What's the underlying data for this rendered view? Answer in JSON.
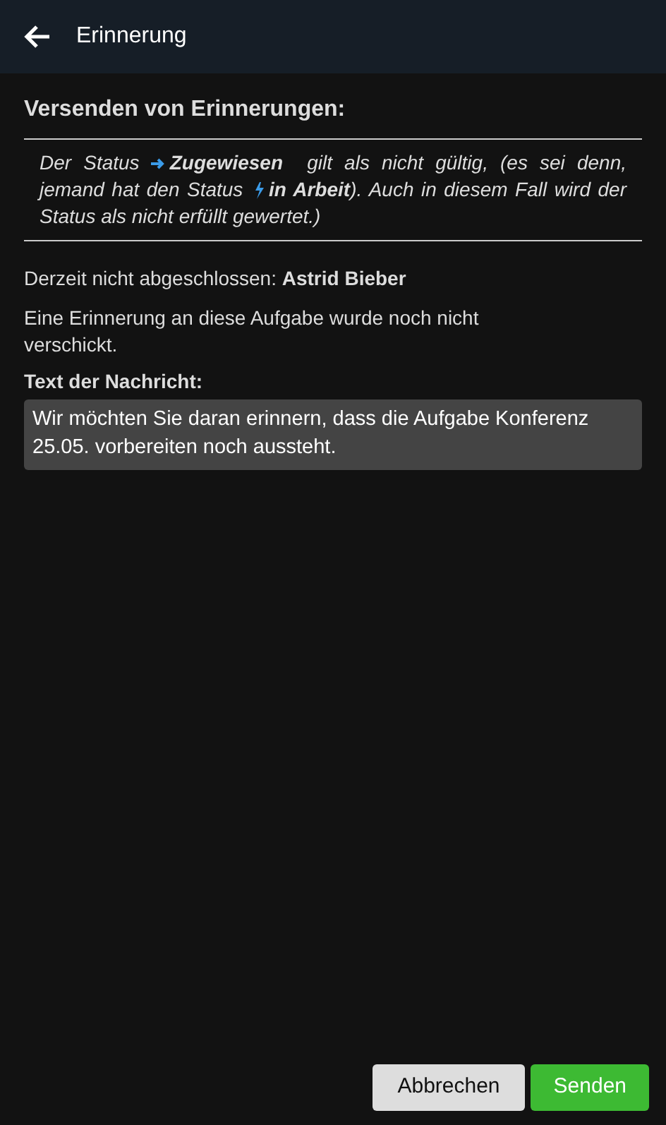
{
  "header": {
    "title": "Erinnerung"
  },
  "section_title": "Versenden von Erinnerungen:",
  "note": [
    {
      "kind": "text",
      "text": "Der Status "
    },
    {
      "kind": "assigned-status",
      "label": "Zugewiesen"
    },
    {
      "kind": "text",
      "text": "  gilt als nicht gültig, (es sei denn, jemand hat den Status "
    },
    {
      "kind": "in-progress-status",
      "label": "in Arbeit"
    },
    {
      "kind": "text",
      "text": "). Auch in diesem Fall wird der Status als nicht erfüllt gewertet.)"
    }
  ],
  "pending": "Derzeit nicht abgeschlossen: **Astrid Bieber**",
  "info": "Eine Erinnerung an diese Aufgabe wurde noch nicht verschickt.",
  "message": {
    "label": "Text der Nachricht:",
    "value": "Wir möchten Sie daran erinnern, dass die Aufgabe Konferenz 25.05. vorbereiten noch aussteht."
  },
  "buttons": [
    {
      "kind": "secondary",
      "label": "Abbrechen"
    },
    {
      "kind": "primary",
      "label": "Senden"
    }
  ]
}
